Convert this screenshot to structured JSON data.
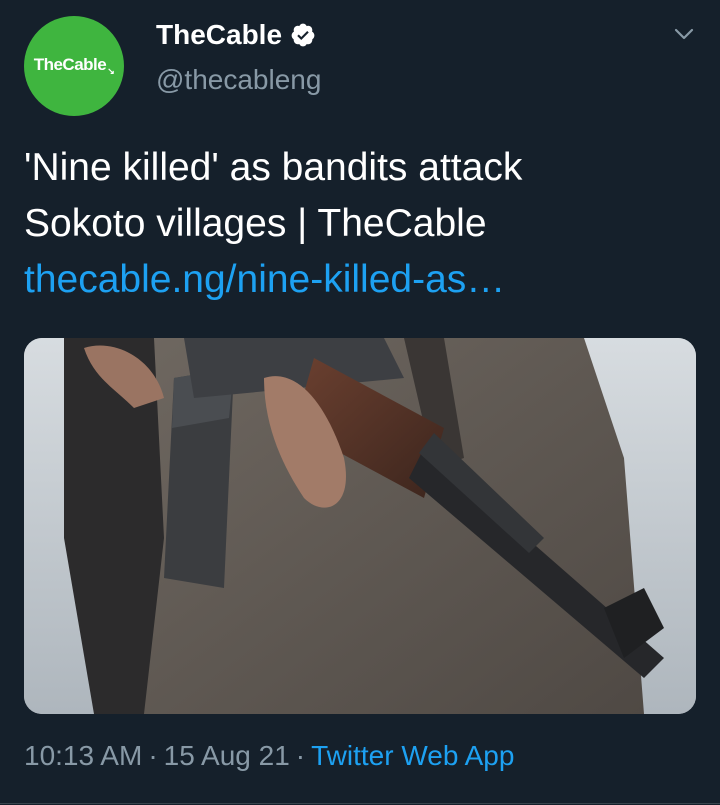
{
  "author": {
    "avatar_text": "TheCable",
    "avatar_mark": "↘",
    "display_name": "TheCable",
    "handle": "@thecableng",
    "verified": true,
    "avatar_color": "#3fb53f"
  },
  "tweet": {
    "text_line_1": "'Nine killed' as bandits attack",
    "text_line_2": "Sokoto villages | TheCable",
    "link_text": "thecable.ng/nine-killed-as…",
    "media_description_icon": "photo-rifle-held"
  },
  "meta": {
    "time": "10:13 AM",
    "separator": "·",
    "date": "15 Aug 21",
    "source": "Twitter Web App"
  },
  "colors": {
    "background": "#15202b",
    "link": "#1da1f2",
    "secondary_text": "#8899a6"
  }
}
